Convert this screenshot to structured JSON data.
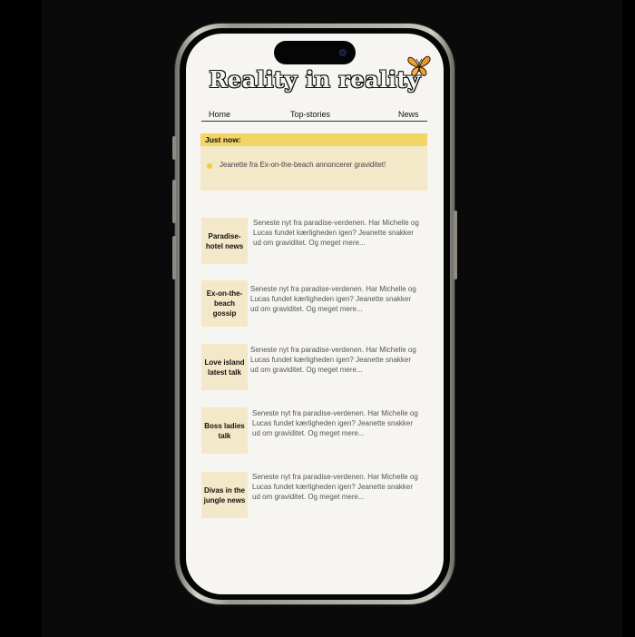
{
  "app": {
    "title": "Reality in reality",
    "logo_icon": "butterfly-icon"
  },
  "nav": {
    "items": [
      "Home",
      "Top-stories",
      "News"
    ]
  },
  "breaking": {
    "heading": "Just now:",
    "item": "Jeanette fra Ex-on-the-beach annoncerer graviditet!"
  },
  "articles": [
    {
      "category": "Paradise-hotel news",
      "excerpt": "Seneste nyt fra paradise-verdenen. Har Michelle og Lucas fundet kærligheden igen? Jeanette snakker ud om graviditet. Og meget mere..."
    },
    {
      "category": "Ex-on-the-beach gossip",
      "excerpt": "Seneste nyt fra paradise-verdenen. Har Michelle og Lucas fundet kærligheden igen? Jeanette snakker ud om graviditet. Og meget mere..."
    },
    {
      "category": "Love island latest talk",
      "excerpt": "Seneste nyt fra paradise-verdenen. Har Michelle og Lucas fundet kærligheden igen? Jeanette snakker ud om graviditet. Og meget mere..."
    },
    {
      "category": "Boss ladies talk",
      "excerpt": "Seneste nyt fra paradise-verdenen. Har Michelle og Lucas fundet kærligheden igen? Jeanette snakker ud om graviditet. Og meget mere..."
    },
    {
      "category": "Divas in the jungle news",
      "excerpt": "Seneste nyt fra paradise-verdenen. Har Michelle og Lucas fundet kærligheden igen? Jeanette snakker ud om graviditet. Og meget mere..."
    }
  ],
  "colors": {
    "accent_yellow": "#f2d565",
    "card_cream": "#f3e8c7",
    "screen_bg": "#f6f5f2",
    "butterfly_orange": "#f0a030"
  }
}
